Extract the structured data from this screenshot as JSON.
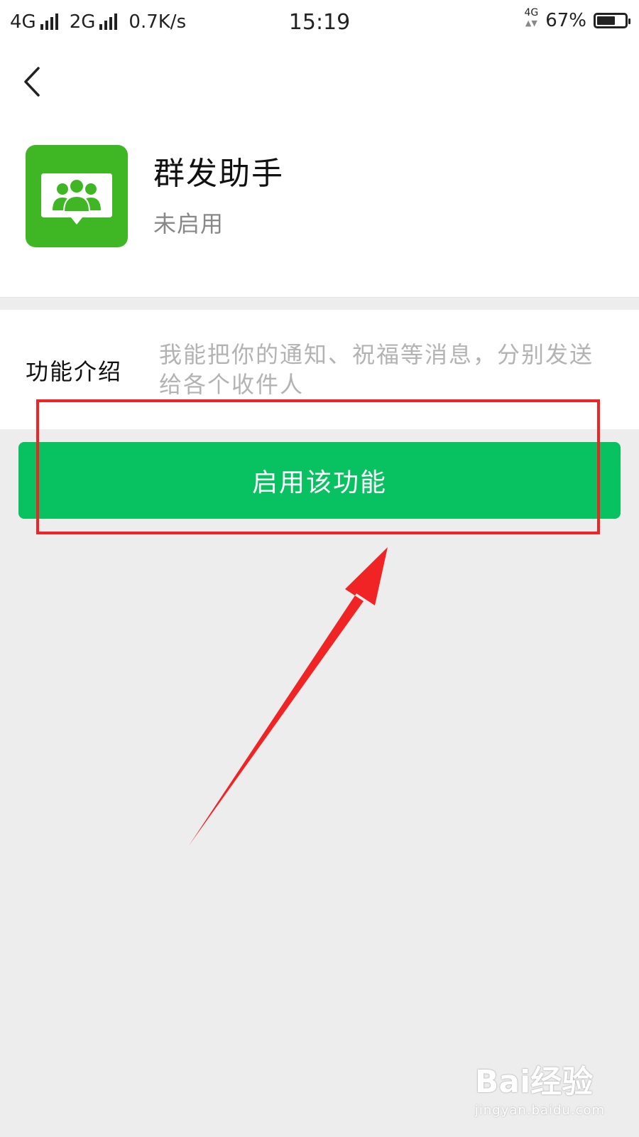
{
  "status_bar": {
    "net1": "4G",
    "net2": "2G",
    "speed": "0.7K/s",
    "time": "15:19",
    "net_mini": "4G",
    "battery_percent": "67%",
    "battery_level": 0.67
  },
  "header": {
    "back_icon": "chevron-left-icon"
  },
  "app": {
    "icon": "group-message-icon",
    "icon_color": "#3fb724",
    "name": "群发助手",
    "status": "未启用"
  },
  "intro": {
    "label": "功能介绍",
    "text": "我能把你的通知、祝福等消息，分别发送给各个收件人"
  },
  "action": {
    "enable_label": "启用该功能",
    "button_color": "#08c160"
  },
  "annotation": {
    "color": "#f02424"
  },
  "watermark": {
    "main": "Bai经验",
    "sub": "jingyan.baidu.com"
  }
}
